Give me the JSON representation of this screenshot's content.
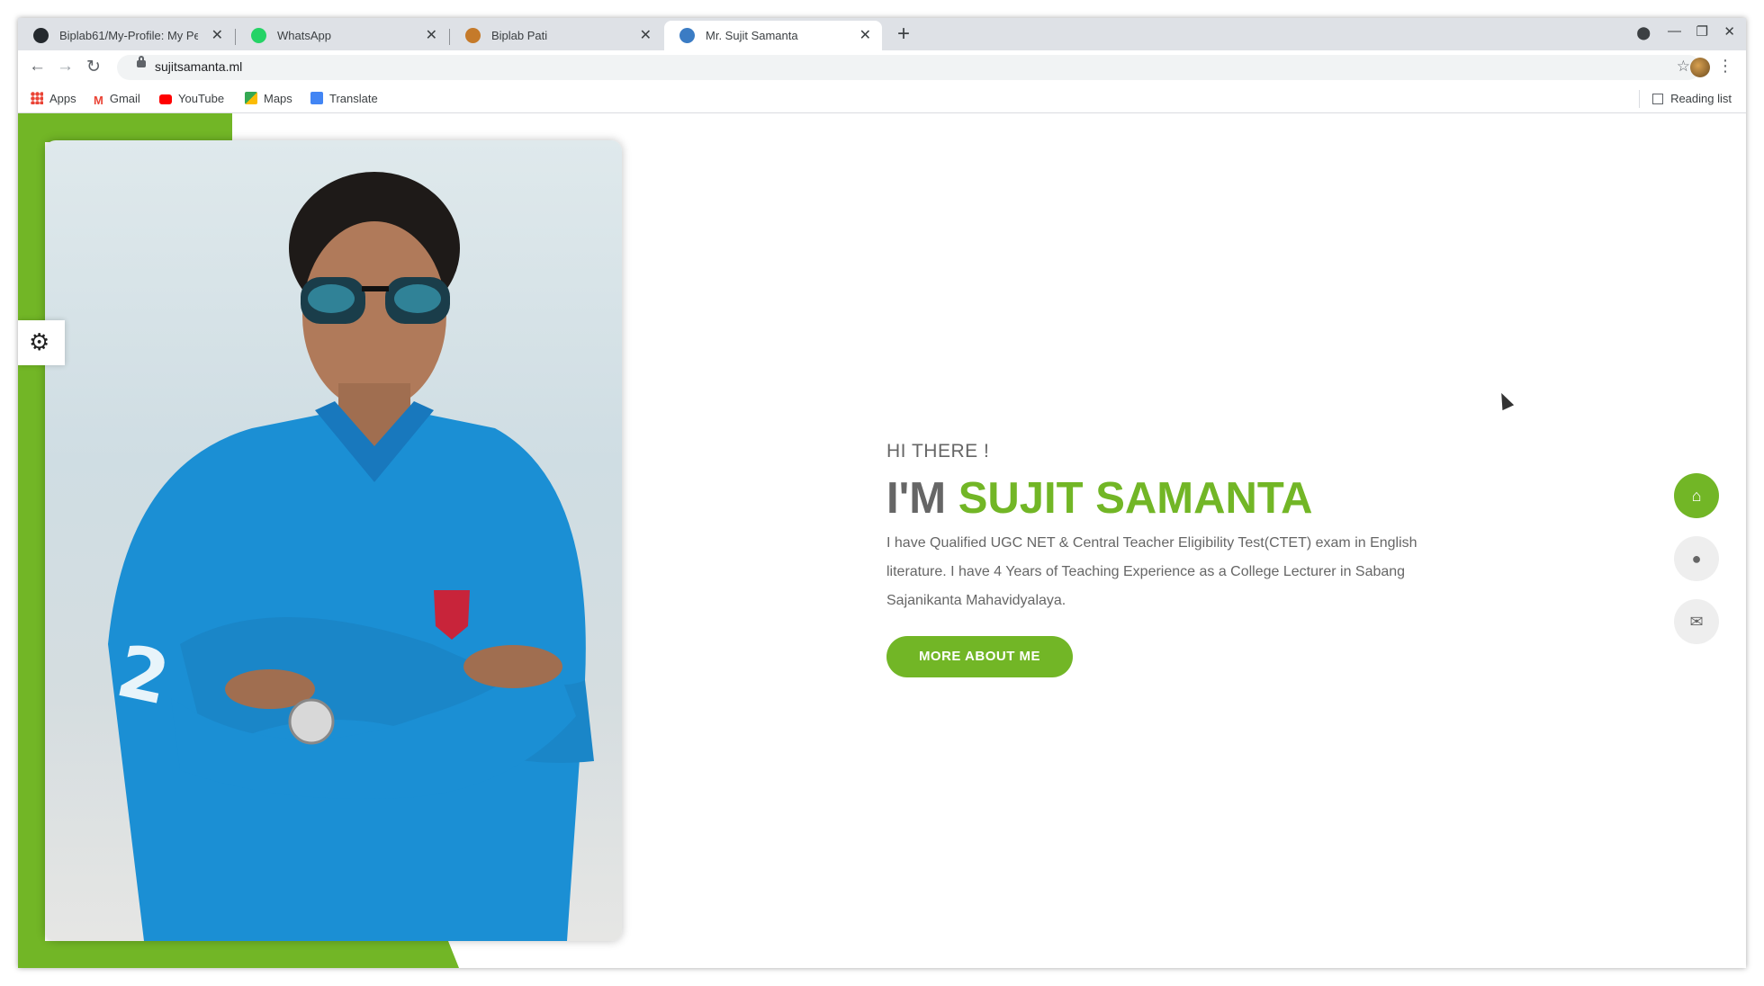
{
  "browser": {
    "tabs": [
      {
        "title": "Biplab61/My-Profile: My Pers",
        "favicon": "github-icon",
        "color": "#24292e"
      },
      {
        "title": "WhatsApp",
        "favicon": "whatsapp-icon",
        "color": "#25d366"
      },
      {
        "title": "Biplab Pati",
        "favicon": "avatar-icon",
        "color": "#c57a2a"
      },
      {
        "title": "Mr. Sujit Samanta",
        "favicon": "avatar-icon",
        "color": "#3b7cc4",
        "active": true
      }
    ],
    "new_tab": "+",
    "close_glyph": "✕",
    "address": "sujitsamanta.ml",
    "bookmarks": [
      {
        "label": "Apps",
        "icon": "apps-grid-icon",
        "color": "#ea4335"
      },
      {
        "label": "Gmail",
        "icon": "gmail-icon",
        "color": "#ea4335"
      },
      {
        "label": "YouTube",
        "icon": "youtube-icon",
        "color": "#ff0000"
      },
      {
        "label": "Maps",
        "icon": "maps-icon",
        "color": "#34a853"
      },
      {
        "label": "Translate",
        "icon": "translate-icon",
        "color": "#4285f4"
      }
    ],
    "reading_list": "Reading list"
  },
  "hero": {
    "greeting": "HI THERE !",
    "name_prefix": "I'M",
    "name": "SUJIT SAMANTA",
    "intro": "I have Qualified UGC NET & Central Teacher Eligibility Test(CTET) exam in English literature. I have 4 Years of Teaching Experience as a College Lecturer in Sabang Sajanikanta Mahavidyalaya.",
    "cta": "MORE ABOUT ME"
  },
  "side_nav": [
    {
      "icon": "home-icon",
      "active": true
    },
    {
      "icon": "user-icon",
      "active": false
    },
    {
      "icon": "envelope-icon",
      "active": false
    }
  ],
  "colors": {
    "accent": "#72b626",
    "text": "#666666"
  }
}
